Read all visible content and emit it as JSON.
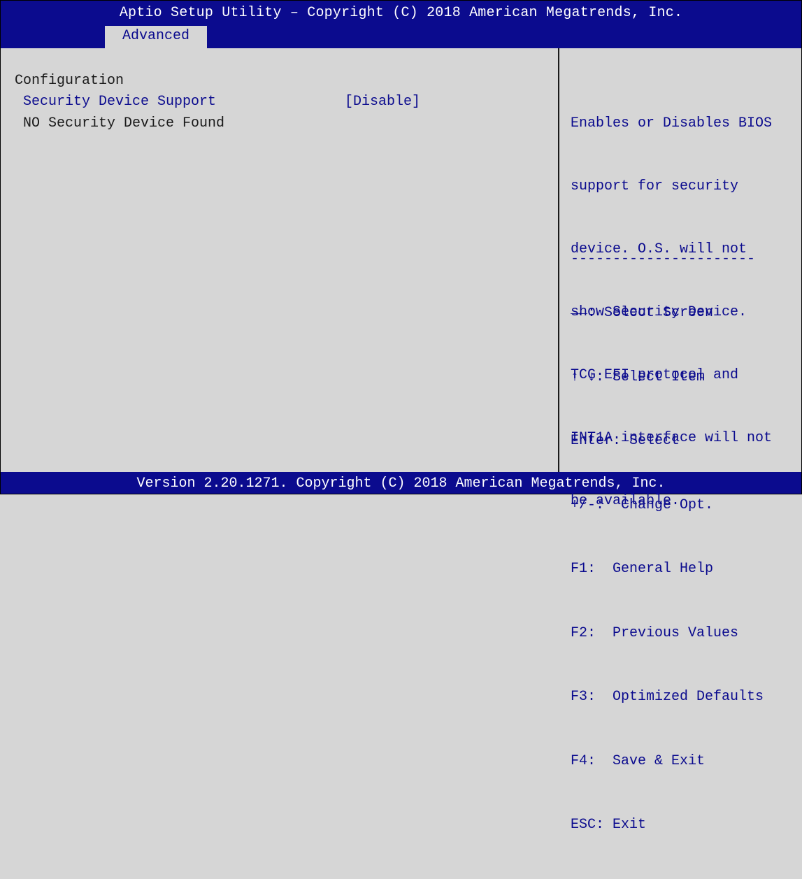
{
  "header": {
    "title": "Aptio Setup Utility – Copyright (C) 2018 American Megatrends, Inc.",
    "tab": "Advanced"
  },
  "main": {
    "section_title": "Configuration",
    "items": [
      {
        "label": "Security Device Support",
        "value": "[Disable]"
      }
    ],
    "status": "NO Security Device Found"
  },
  "help_panel": {
    "description": [
      "Enables or Disables BIOS",
      "support for security",
      "device. O.S. will not",
      "show Security Device.",
      "TCG EFI protocol and",
      "INT1A interface will not",
      "be available."
    ],
    "separator": "----------------------",
    "keys": [
      {
        "key": "→←:",
        "desc": " Select Screen"
      },
      {
        "key": "↑ ↓:",
        "desc": " Select Item"
      },
      {
        "key": "Enter:",
        "desc": " Select"
      },
      {
        "key": "+/-:",
        "desc": "  Change Opt."
      },
      {
        "key": "F1:",
        "desc": "  General Help"
      },
      {
        "key": "F2:",
        "desc": "  Previous Values"
      },
      {
        "key": "F3:",
        "desc": "  Optimized Defaults"
      },
      {
        "key": "F4:",
        "desc": "  Save & Exit"
      },
      {
        "key": "ESC:",
        "desc": " Exit"
      }
    ]
  },
  "footer": {
    "version": "Version 2.20.1271. Copyright (C) 2018 American Megatrends, Inc."
  },
  "colors": {
    "background": "#d6d6d6",
    "header_blue": "#0b0b8e",
    "text_dark": "#1a1a1a",
    "text_white": "#ffffff"
  }
}
